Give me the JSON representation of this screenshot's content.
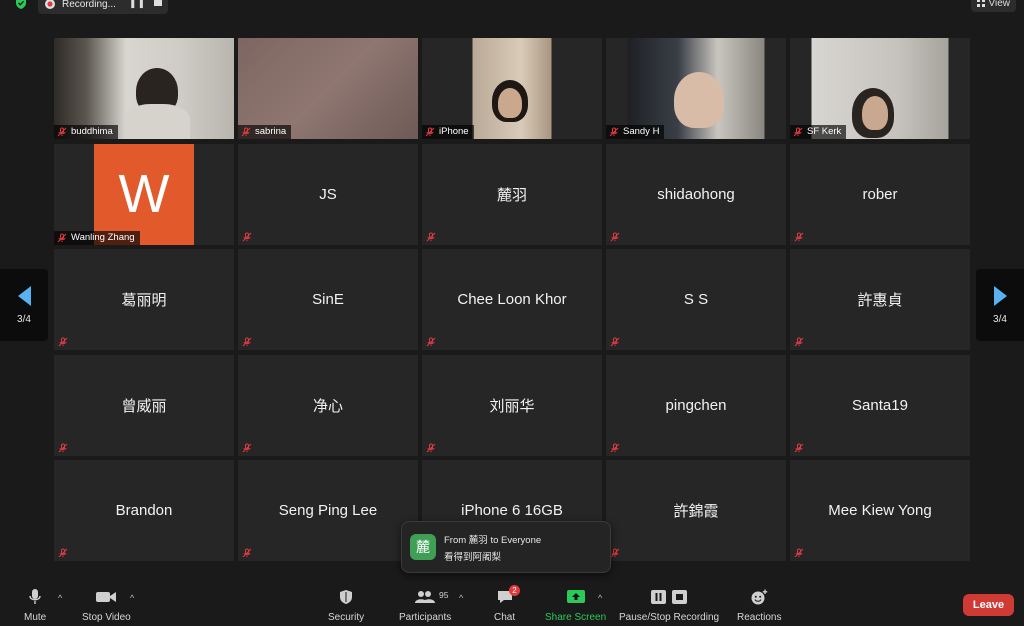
{
  "top": {
    "recording_label": "Recording...",
    "view_label": "View"
  },
  "tiles": [
    {
      "name": "buddhima",
      "type": "video"
    },
    {
      "name": "sabrina",
      "type": "video"
    },
    {
      "name": "iPhone",
      "type": "video"
    },
    {
      "name": "Sandy H",
      "type": "video"
    },
    {
      "name": "SF Kerk",
      "type": "video"
    },
    {
      "name": "Wanling Zhang",
      "type": "avatar",
      "avatar_letter": "W",
      "avatar_color": "#e2592b"
    },
    {
      "name": "JS"
    },
    {
      "name": "麓羽"
    },
    {
      "name": "shidaohong"
    },
    {
      "name": "rober"
    },
    {
      "name": "葛丽明"
    },
    {
      "name": "SinE"
    },
    {
      "name": "Chee Loon Khor"
    },
    {
      "name": "S S"
    },
    {
      "name": "許惠貞"
    },
    {
      "name": "曾威丽"
    },
    {
      "name": "净心"
    },
    {
      "name": "刘丽华"
    },
    {
      "name": "pingchen"
    },
    {
      "name": "Santa19"
    },
    {
      "name": "Brandon"
    },
    {
      "name": "Seng Ping Lee"
    },
    {
      "name": "iPhone 6 16GB"
    },
    {
      "name": "許錦霞"
    },
    {
      "name": "Mee Kiew Yong"
    }
  ],
  "pager": {
    "left": "3/4",
    "right": "3/4",
    "arrow_color": "#5ab0f0"
  },
  "chat_popup": {
    "avatar_char": "麓",
    "from": "From 麓羽 to Everyone",
    "message": "看得到阿阇梨"
  },
  "toolbar": {
    "mute": "Mute",
    "stop_video": "Stop Video",
    "security": "Security",
    "participants": "Participants",
    "participants_count": "95",
    "chat": "Chat",
    "chat_badge": "2",
    "share_screen": "Share Screen",
    "share_color": "#2bc85a",
    "pause_stop_recording": "Pause/Stop Recording",
    "reactions": "Reactions",
    "leave": "Leave",
    "leave_color": "#cf3b34"
  }
}
